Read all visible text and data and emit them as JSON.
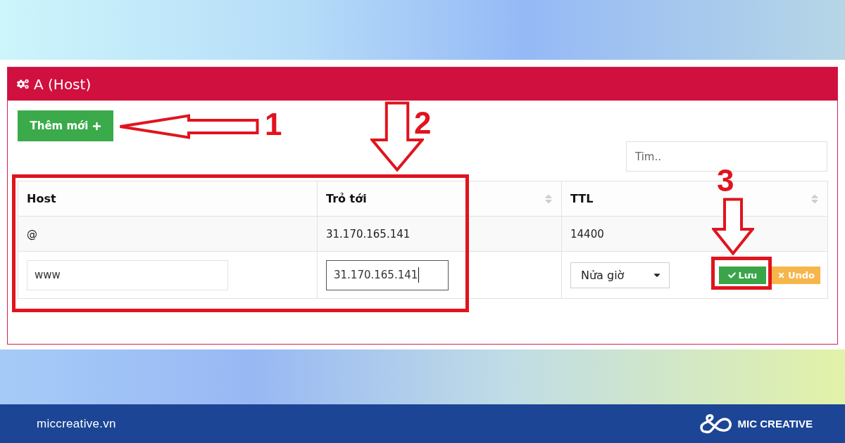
{
  "panel": {
    "title": "A (Host)",
    "add_button": "Thêm mới",
    "search": {
      "placeholder": "Tim.."
    },
    "table": {
      "columns": [
        {
          "label": "Host",
          "sortable": false
        },
        {
          "label": "Trỏ tới",
          "sortable": true
        },
        {
          "label": "TTL",
          "sortable": true
        }
      ],
      "rows": [
        {
          "kind": "record",
          "cells": [
            "@",
            "31.170.165.141",
            "14400"
          ]
        },
        {
          "kind": "edit",
          "fields": [
            {
              "value": "www",
              "focused": false
            },
            {
              "value": "31.170.165.141",
              "focused": true
            }
          ],
          "ttl_select": {
            "value": "Nửa giờ"
          },
          "actions": [
            {
              "kind": "save",
              "label": "Lưu"
            },
            {
              "kind": "undo",
              "label": "Undo"
            }
          ]
        }
      ]
    }
  },
  "markers": [
    {
      "kind": "left",
      "label": "1",
      "frame": false
    },
    {
      "kind": "down",
      "label": "2",
      "frame": true
    },
    {
      "kind": "down",
      "label": "3",
      "frame": true
    }
  ],
  "footer": {
    "site": "miccreative.vn",
    "brand": "MIC CREATIVE"
  }
}
